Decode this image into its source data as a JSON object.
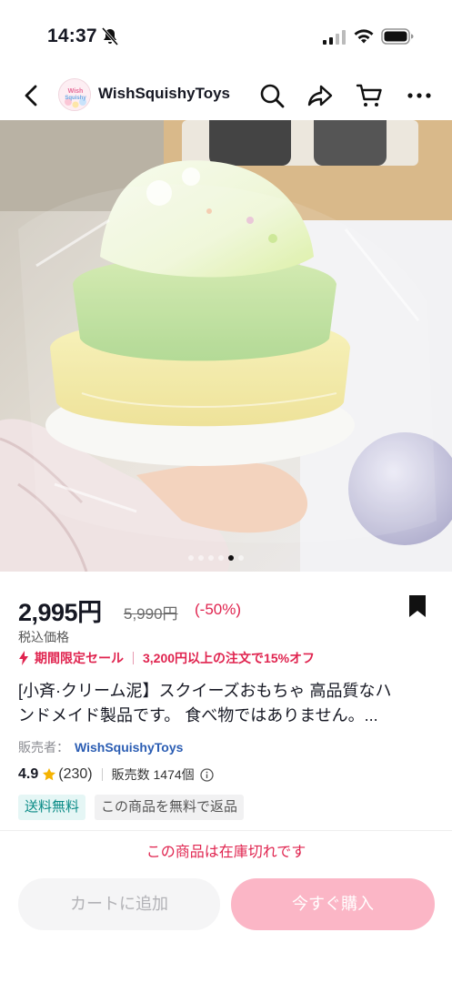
{
  "status_bar": {
    "time": "14:37",
    "icons": [
      "bell-off-icon",
      "signal-icon",
      "wifi-icon",
      "battery-icon"
    ]
  },
  "nav": {
    "store_name": "WishSquishyToys",
    "avatar_logo_text": "Wish Squishy",
    "icons": [
      "back-arrow-icon",
      "search-icon",
      "share-icon",
      "cart-icon",
      "more-icon"
    ]
  },
  "gallery": {
    "image_count": 6,
    "active_index": 4,
    "image_label": "product-photo"
  },
  "product": {
    "price": "2,995円",
    "original_price": "5,990円",
    "discount": "(-50%)",
    "tax_note": "税込価格",
    "promo_sale": "期間限定セール",
    "promo_offer": "3,200円以上の注文で15%オフ",
    "title_line1": "[小斉·クリーム泥】スクイーズおもちゃ 高品質なハ",
    "title_line2": "ンドメイド製品です。 食べ物ではありません。...",
    "seller_label": "販売者：",
    "seller_name": "WishSquishyToys",
    "rating": "4.9",
    "rating_count": "(230)",
    "sold_count": "販売数 1474個",
    "tag_shipping": "送料無料",
    "tag_return": "この商品を無料で返品",
    "stock_message": "この商品は在庫切れです"
  },
  "actions": {
    "add_to_cart": "カートに追加",
    "buy_now": "今すぐ購入"
  },
  "colors": {
    "accent_red": "#e0244f",
    "buy_button": "#fbb6c6",
    "seller_link": "#2b5db3",
    "shipping_tag": "#0a8b86"
  }
}
